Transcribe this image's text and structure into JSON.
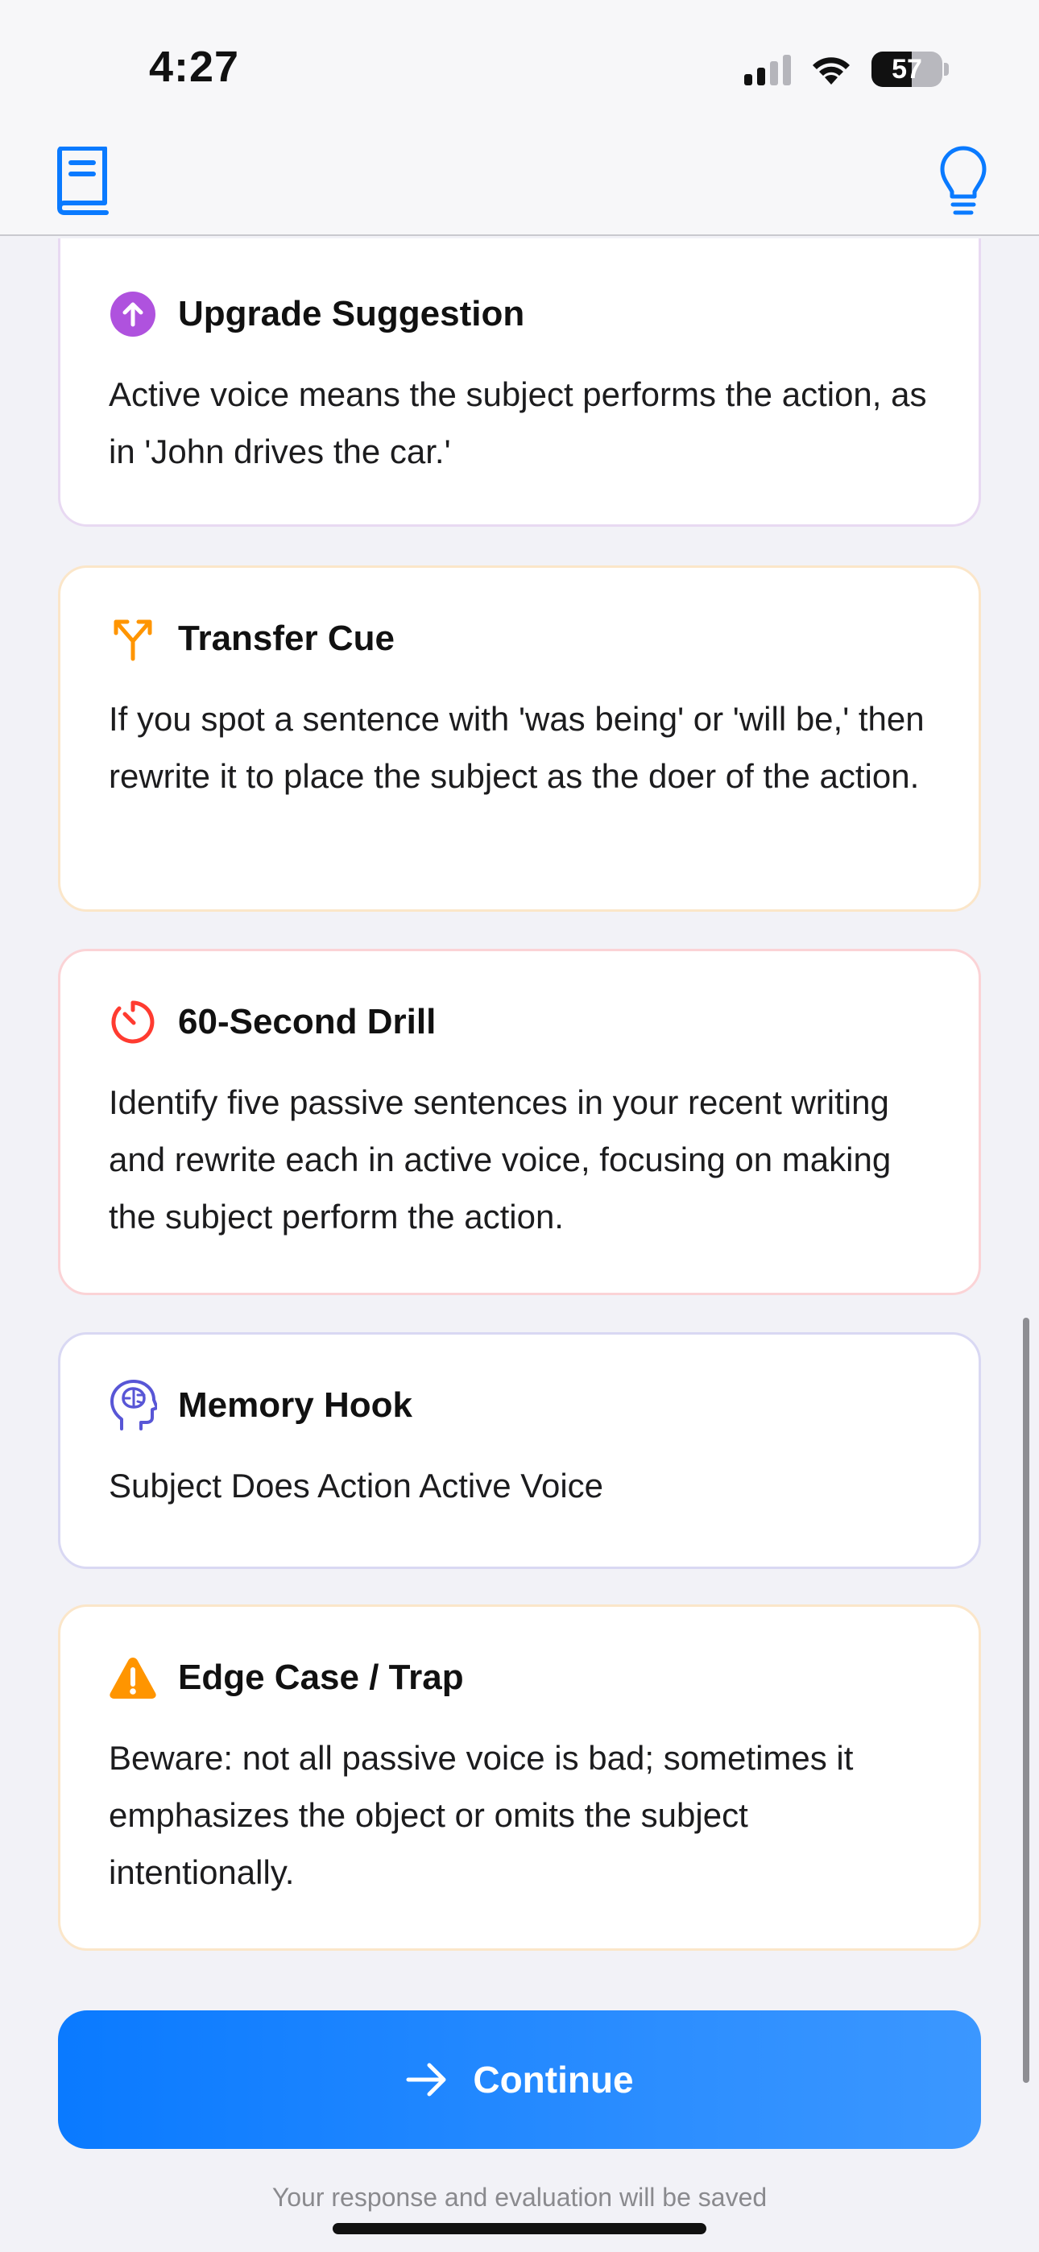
{
  "status_bar": {
    "time": "4:27",
    "battery_level": "57"
  },
  "nav": {
    "left_icon": "book-icon",
    "right_icon": "lightbulb-icon",
    "accent": "#0a7aff"
  },
  "cards": [
    {
      "title": "Upgrade Suggestion",
      "icon": "arrow-up-circle-icon",
      "accent": "#af52de",
      "body": "Active voice means the subject performs the action, as in 'John drives the car.'"
    },
    {
      "title": "Transfer Cue",
      "icon": "fork-arrow-icon",
      "accent": "#ff9500",
      "body": "If you spot a sentence with 'was being' or 'will be,' then rewrite it to place the subject as the doer of the action."
    },
    {
      "title": "60-Second Drill",
      "icon": "timer-icon",
      "accent": "#ff3b30",
      "body": "Identify five passive sentences in your recent writing and rewrite each in active voice, focusing on making the subject perform the action."
    },
    {
      "title": "Memory Hook",
      "icon": "brain-head-icon",
      "accent": "#5856d6",
      "body": "Subject Does Action Active Voice"
    },
    {
      "title": "Edge Case / Trap",
      "icon": "warning-triangle-icon",
      "accent": "#ff9500",
      "body": "Beware: not all passive voice is bad; sometimes it emphasizes the object or omits the subject intentionally."
    }
  ],
  "actions": {
    "continue_label": "Continue",
    "continue_icon": "arrow-right-icon",
    "footnote": "Your response and evaluation will be saved"
  }
}
